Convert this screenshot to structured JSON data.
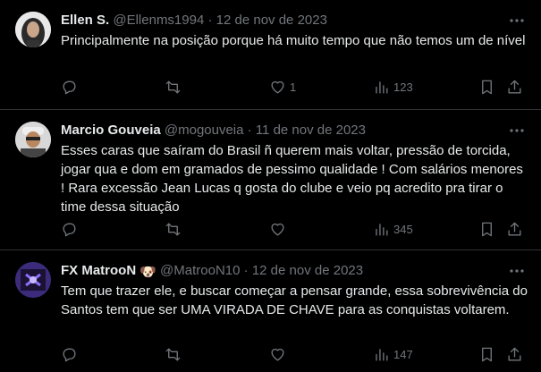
{
  "tweets": [
    {
      "name": "Ellen S.",
      "handle": "@Ellenms1994",
      "date": "12 de nov de 2023",
      "text": "Principalmente na posição porque há muito tempo que não temos um de nível",
      "likes": "1",
      "views": "123",
      "avatar_icon": "profile-photo"
    },
    {
      "name": "Marcio Gouveia",
      "handle": "@mogouveia",
      "date": "11 de nov de 2023",
      "text": "Esses caras que saíram do Brasil ñ querem mais voltar, pressão de torcida, jogar qua e dom  em gramados de pessimo qualidade ! Com salários menores  ! Rara excessão Jean Lucas q gosta do clube e veio pq acredito pra tirar o time dessa situação",
      "likes": "",
      "views": "345",
      "avatar_icon": "profile-photo"
    },
    {
      "name": "FX MatrooN",
      "emoji": "🐶",
      "handle": "@MatrooN10",
      "date": "12 de nov de 2023",
      "text": "Tem que trazer ele, e buscar começar a pensar grande, essa sobrevivência do Santos tem que ser UMA VIRADA DE CHAVE para as conquistas voltarem.",
      "likes": "",
      "views": "147",
      "avatar_icon": "profile-photo"
    }
  ],
  "separator": "·",
  "icons": [
    "reply-icon",
    "retweet-icon",
    "like-icon",
    "views-icon",
    "bookmark-icon",
    "share-icon",
    "more-icon"
  ],
  "colors": {
    "background": "#000000",
    "text": "#e7e9ea",
    "muted": "#71767b",
    "border": "#2f3336"
  }
}
